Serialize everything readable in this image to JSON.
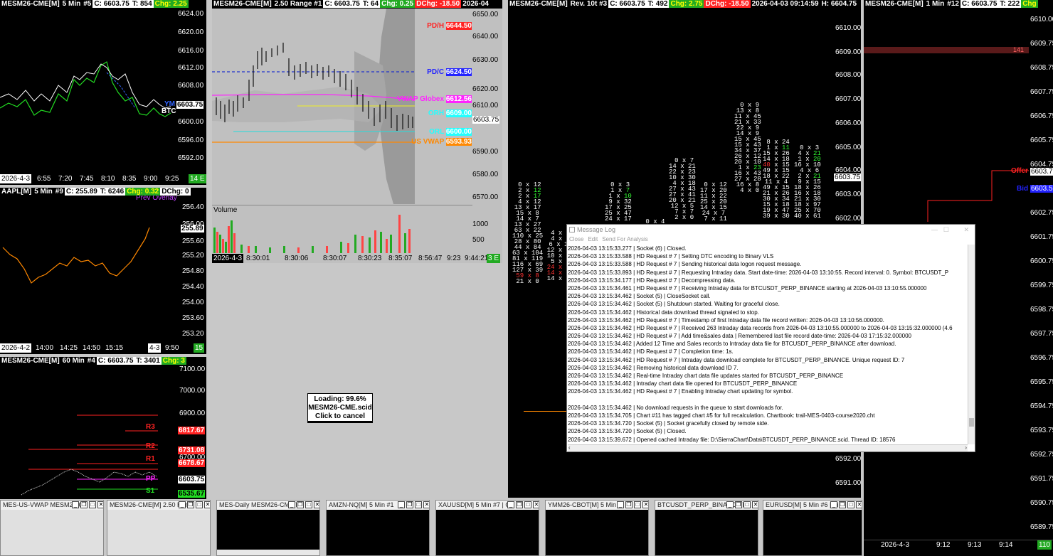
{
  "chart1": {
    "header": [
      "MESM26-CME[M]",
      "5 Min",
      "#5",
      "C: 6603.75",
      "T: 854",
      "Chg: 2.25"
    ],
    "y_labels": [
      "6624.00",
      "6620.00",
      "6616.00",
      "6612.00",
      "6608.00",
      "6604.00",
      "6600.00",
      "6596.00",
      "6592.00"
    ],
    "price_tag": "6603.75",
    "series_tags": [
      "YM",
      "BTC"
    ],
    "x_labels": [
      "2026-4-3",
      "6:55",
      "7:20",
      "7:45",
      "8:10",
      "8:35",
      "9:00",
      "9:25"
    ],
    "badge": "14 E",
    "colors": {
      "line1": "#22dd22",
      "line2": "#ffffff",
      "line3": "#3366ff"
    }
  },
  "chart2": {
    "header": [
      "MESM26-CME[M]",
      "2.50 Range #1",
      "C: 6603.75",
      "T: 64",
      "Chg: 0.25",
      "DChg: -18.50",
      "2026-04"
    ],
    "y_labels": [
      "6650.00",
      "6640.00",
      "6630.00",
      "6620.00",
      "6610.00",
      "6600.00",
      "6590.00",
      "6580.00",
      "6570.00"
    ],
    "level_labels": [
      {
        "name": "PD/H",
        "value": "6644.50",
        "color": "#ff2222"
      },
      {
        "name": "PD/C",
        "value": "6624.50",
        "color": "#2222ff"
      },
      {
        "name": "VWAP Globex",
        "value": "6612.56",
        "color": "#ff22ff"
      },
      {
        "name": "ORH",
        "value": "6609.00",
        "color": "#22ffff"
      },
      {
        "name": "ORL",
        "value": "6600.00",
        "color": "#22ffff"
      },
      {
        "name": "US VWAP",
        "value": "6593.93",
        "color": "#ff8800"
      }
    ],
    "price_tag": "6603.75",
    "volume_label": "Volume",
    "volume_axis": [
      "1000",
      "500"
    ],
    "x_labels": [
      "2026-4-3",
      "8:30:01",
      "8:30:06",
      "8:30:07",
      "8:30:23",
      "8:35:07",
      "8:56:47",
      "9:23",
      "9:44:21"
    ],
    "badge": "3 E"
  },
  "chart3": {
    "header": [
      "AAPL[M]",
      "5 Min",
      "#9",
      "C: 255.89",
      "T: 6246",
      "Chg: 0.32",
      "DChg: 0"
    ],
    "overlay": "Prev Overlay",
    "y_labels": [
      "256.40",
      "256.00",
      "255.60",
      "255.20",
      "254.80",
      "254.40",
      "254.00",
      "253.60",
      "253.20"
    ],
    "price_tag": "255.89",
    "x_labels": [
      "2026-4-2",
      "14:00",
      "14:25",
      "14:50",
      "15:15",
      "4-3",
      "9:50"
    ],
    "badge": "15"
  },
  "chart4": {
    "header": [
      "MESM26-CME[M]",
      "60 Min",
      "#4",
      "C: 6603.75",
      "T: 3401",
      "Chg: 3"
    ],
    "y_labels": [
      "7100.00",
      "7000.00",
      "6900.00",
      "6800.00",
      "6700.00",
      "6600.00"
    ],
    "pivots": [
      {
        "name": "R3",
        "value": "6817.67",
        "color": "#ff2222"
      },
      {
        "name": "R2",
        "value": "6731.08",
        "color": "#ff2222"
      },
      {
        "name": "R1",
        "value": "6678.67",
        "color": "#ff2222"
      },
      {
        "name": "PP",
        "value": "6603.75",
        "color": "#ff22ff"
      },
      {
        "name": "S1",
        "value": "6535.67",
        "color": "#22dd22"
      }
    ]
  },
  "chart5": {
    "header": [
      "MESM26-CME[M]",
      "Rev. 10t #3",
      "C: 6603.75",
      "T: 492",
      "Chg: 2.75",
      "DChg: -18.50",
      "2026-04-03  09:14:59",
      "H: 6604.75"
    ],
    "y_labels": [
      "6610.00",
      "6609.00",
      "6608.00",
      "6607.00",
      "6606.00",
      "6605.00",
      "6604.00",
      "6603.00",
      "6602.00",
      "6601.00",
      "6600.00",
      "6599.00",
      "6598.00",
      "6597.00",
      "6596.00",
      "6595.00",
      "6594.00",
      "6593.00",
      "6592.00",
      "6591.00"
    ],
    "price_tag": "6603.75"
  },
  "chart6": {
    "header": [
      "MESM26-CME[M]",
      "1 Min",
      "#12",
      "C: 6603.75",
      "T: 222",
      "Chg"
    ],
    "y_labels": [
      "6610.00",
      "6609.75",
      "6608.75",
      "6607.75",
      "6606.75",
      "6605.75",
      "6604.75",
      "6603.75",
      "6602.75",
      "6601.75",
      "6600.75",
      "6599.75",
      "6598.75",
      "6597.75",
      "6596.75",
      "6595.75",
      "6594.75",
      "6593.75",
      "6592.75",
      "6591.75",
      "6590.75",
      "6589.75"
    ],
    "level_tag": "141",
    "offer_label": "Offer",
    "bid_label": "Bid",
    "bid_value": "6603.50",
    "price_tag": "6603.75",
    "x_labels": [
      "2026-4-3",
      "9:12",
      "9:13",
      "9:14"
    ],
    "badge": "110"
  },
  "loading": {
    "line1": "Loading: 99.6%",
    "line2": "MESM26-CME.scid",
    "line3": "Click to cancel"
  },
  "message_log": {
    "title": "Message Log",
    "menu": [
      "Close",
      "Edit",
      "Send For Analysis"
    ],
    "lines": [
      "2026-04-03  13:15:33.277 | Socket (6) | Closed.",
      "2026-04-03  13:15:33.588 | HD Request # 7 | Setting DTC encoding to Binary VLS",
      "2026-04-03  13:15:33.588 | HD Request # 7 | Sending historical data logon request message.",
      "2026-04-03  13:15:33.893 | HD Request # 7 | Requesting Intraday data.  Start date-time: 2026-04-03  13:10:55. Record interval: 0. Symbol: BTCUSDT_P",
      "2026-04-03  13:15:34.177 | HD Request # 7 | Decompressing data.",
      "2026-04-03  13:15:34.461 | HD Request # 7 | Receiving Intraday data for BTCUSDT_PERP_BINANCE starting at 2026-04-03  13:10:55.000000",
      "2026-04-03  13:15:34.462 | Socket (5) | CloseSocket call.",
      "2026-04-03  13:15:34.462 | Socket (5) | Shutdown started.  Waiting for graceful close.",
      "2026-04-03  13:15:34.462 | Historical data download thread signaled to stop.",
      "2026-04-03  13:15:34.462 | HD Request # 7 | Timestamp of first Intraday data file record written: 2026-04-03  13:10:56.000000.",
      "2026-04-03  13:15:34.462 | HD Request # 7 | Received 263 Intraday data records from 2026-04-03  13:10:55.000000 to 2026-04-03  13:15:32.000000 (4.6",
      "2026-04-03  13:15:34.462 | HD Request # 7 | Add time&sales data | Remembered last file record date-time: 2026-04-03  17:15:32.000000",
      "2026-04-03  13:15:34.462 | Added 12 Time and Sales records to Intraday data file for BTCUSDT_PERP_BINANCE after download.",
      "2026-04-03  13:15:34.462 | HD Request # 7 | Completion time: 1s.",
      "2026-04-03  13:15:34.462 | HD Request # 7 | Intraday data download complete for BTCUSDT_PERP_BINANCE. Unique request ID: 7",
      "2026-04-03  13:15:34.462 | Removing historical data download ID 7.",
      "2026-04-03  13:15:34.462 | Real-time Intraday chart data file updates started for BTCUSDT_PERP_BINANCE",
      "2026-04-03  13:15:34.462 | Intraday chart data file opened for BTCUSDT_PERP_BINANCE",
      "2026-04-03  13:15:34.462 | HD Request # 7 | Enabling Intraday chart updating for symbol.",
      "",
      "2026-04-03  13:15:34.462 | No download requests in the queue to start downloads for.",
      "2026-04-03  13:15:34.705 | Chart #11 has tagged chart #5 for full recalculation. Chartbook: trail-MES-0403-course2020.cht",
      "2026-04-03  13:15:34.720 | Socket (5) | Socket gracefully closed by remote side.",
      "2026-04-03  13:15:34.720 | Socket (5) | Closed.",
      "2026-04-03  13:15:39.672 | Opened cached Intraday file: D:\\SierraChart\\Data\\BTCUSDT_PERP_BINANCE.scid. Thread ID: 18576"
    ]
  },
  "minimized": [
    "MES-US-VWAP MESM26-C",
    "MESM26-CME[M]  2.50 Ran",
    "MES-Daily MESM26-CME[M",
    "AMZN-NQ[M]  5 Min  #1",
    "XAUUSD[M]  5 Min  #7 | Gd",
    "YMM26-CBOT[M]  5 Min  #",
    "BTCUSDT_PERP_BINANCE[M",
    "EURUSD[M]  5 Min  #6 | Fi"
  ]
}
